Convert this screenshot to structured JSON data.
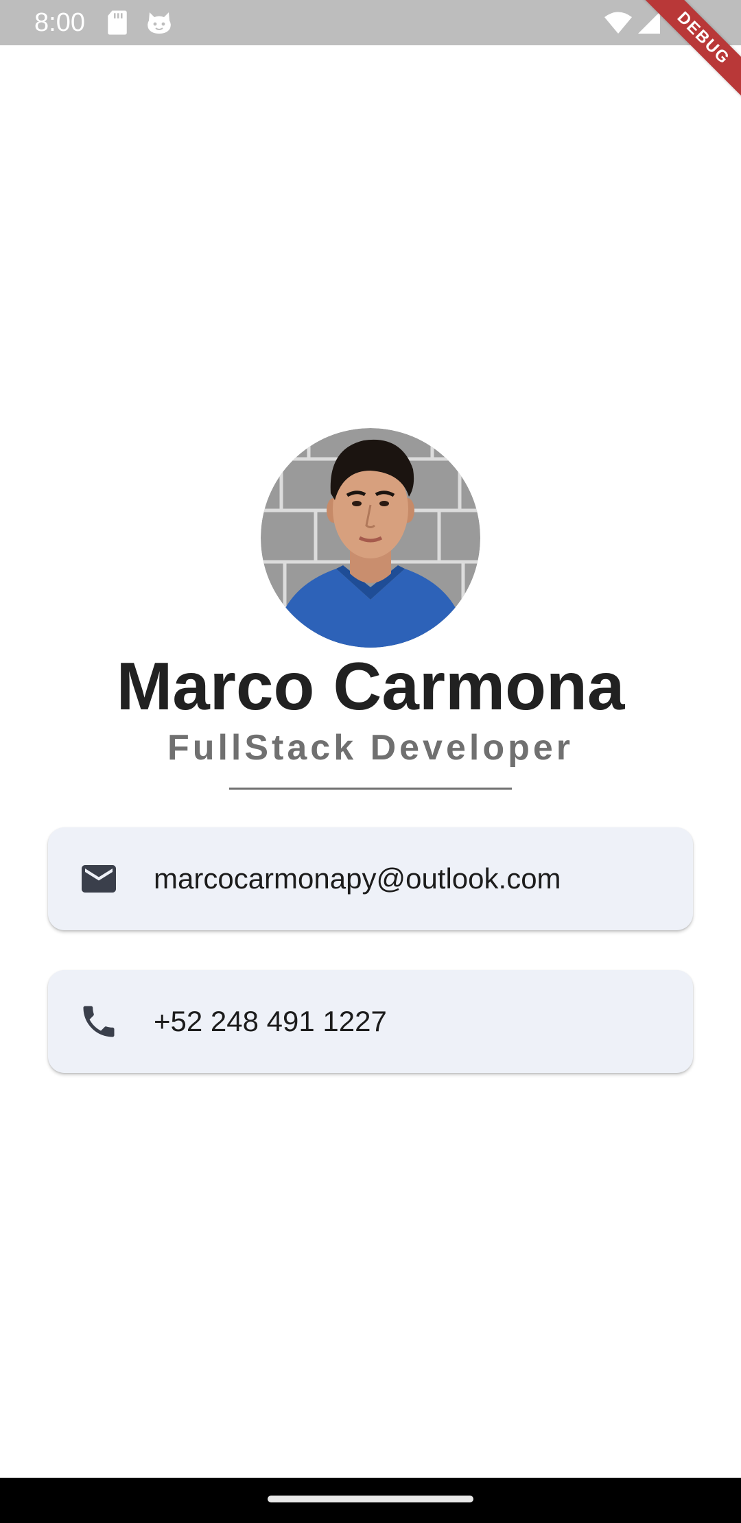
{
  "status_bar": {
    "time": "8:00",
    "icons": [
      "sd-card-icon",
      "cat-face-icon",
      "wifi-icon",
      "signal-icon"
    ]
  },
  "debug_banner": {
    "label": "DEBUG",
    "color": "#b93838"
  },
  "profile": {
    "name": "Marco Carmona",
    "role": "FullStack Developer",
    "avatar_icon": "profile-photo"
  },
  "contacts": [
    {
      "icon": "email-icon",
      "text": "marcocarmonapy@outlook.com"
    },
    {
      "icon": "phone-icon",
      "text": "+52 248 491 1227"
    }
  ],
  "colors": {
    "background": "#ffffff",
    "status_bar": "#bdbdbd",
    "card_background": "#eef1f8",
    "name_text": "#212121",
    "role_text": "#707070",
    "icon": "#3a3f4b"
  }
}
